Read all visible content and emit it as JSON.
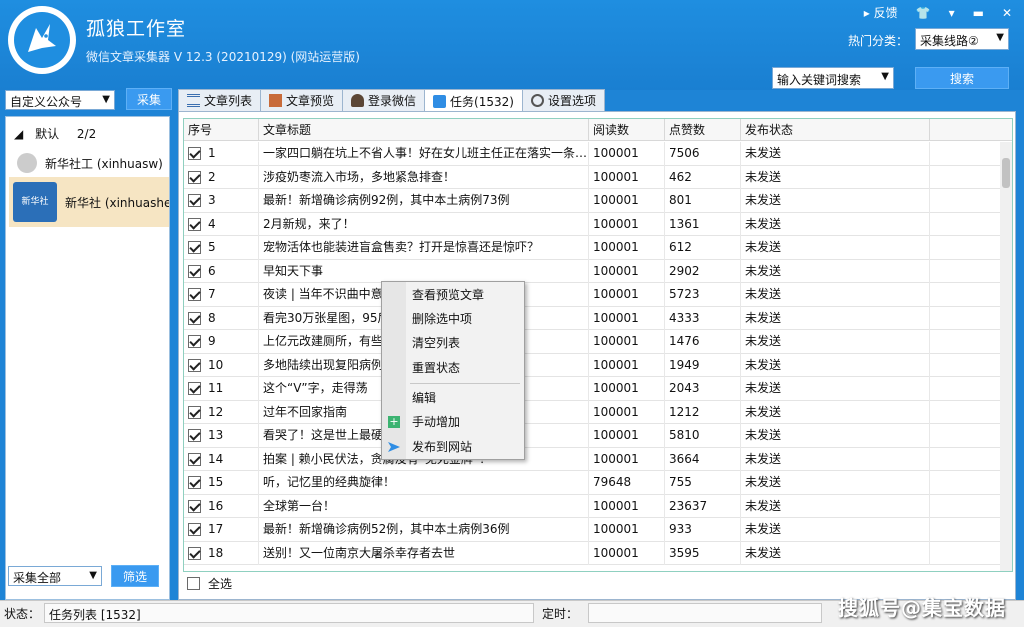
{
  "app": {
    "title": "孤狼工作室",
    "subtitle": "微信文章采集器  V 12.3 (20210129) (网站运营版)"
  },
  "top_links": {
    "feedback": "反馈"
  },
  "hot": {
    "label": "热门分类：",
    "value": "采集线路②"
  },
  "search": {
    "keyword_select": "输入关键词搜索",
    "button": "搜索"
  },
  "left": {
    "source_select": "自定义公众号",
    "collect_button": "采集",
    "group_name": "默认",
    "group_count": "2/2",
    "accounts": [
      {
        "name": "新华社工 (xinhuasw)",
        "icon_text": ""
      },
      {
        "name": "新华社 (xinhuashe",
        "icon_text": "新华社"
      }
    ],
    "all_select": "采集全部",
    "filter_button": "筛选"
  },
  "tabs": [
    {
      "label": "文章列表"
    },
    {
      "label": "文章预览"
    },
    {
      "label": "登录微信"
    },
    {
      "label": "任务(1532)"
    },
    {
      "label": "设置选项"
    }
  ],
  "table": {
    "headers": [
      "序号",
      "文章标题",
      "阅读数",
      "点赞数",
      "发布状态"
    ],
    "rows": [
      {
        "no": "1",
        "title": "一家四口躺在坑上不省人事！好在女儿班主任正在落实一条…",
        "reads": "100001",
        "likes": "7506",
        "status": "未发送"
      },
      {
        "no": "2",
        "title": "涉疫奶枣流入市场，多地紧急排查！",
        "reads": "100001",
        "likes": "462",
        "status": "未发送"
      },
      {
        "no": "3",
        "title": "最新！新增确诊病例92例，其中本土病例73例",
        "reads": "100001",
        "likes": "801",
        "status": "未发送"
      },
      {
        "no": "4",
        "title": "2月新规，来了！",
        "reads": "100001",
        "likes": "1361",
        "status": "未发送"
      },
      {
        "no": "5",
        "title": "宠物活体也能装进盲盒售卖？打开是惊喜还是惊吓？",
        "reads": "100001",
        "likes": "612",
        "status": "未发送"
      },
      {
        "no": "6",
        "title": "早知天下事",
        "reads": "100001",
        "likes": "2902",
        "status": "未发送"
      },
      {
        "no": "7",
        "title": "夜读 | 当年不识曲中意",
        "reads": "100001",
        "likes": "5723",
        "status": "未发送"
      },
      {
        "no": "8",
        "title": "看完30万张星图，95后",
        "reads": "100001",
        "likes": "4333",
        "status": "未发送"
      },
      {
        "no": "9",
        "title": "上亿元改建厕所，有些",
        "reads": "100001",
        "likes": "1476",
        "status": "未发送"
      },
      {
        "no": "10",
        "title": "多地陆续出现复阳病例",
        "reads": "100001",
        "likes": "1949",
        "status": "未发送"
      },
      {
        "no": "11",
        "title": "这个“V”字，走得荡",
        "reads": "100001",
        "likes": "2043",
        "status": "未发送"
      },
      {
        "no": "12",
        "title": "过年不回家指南",
        "reads": "100001",
        "likes": "1212",
        "status": "未发送"
      },
      {
        "no": "13",
        "title": "看哭了！这是世上最硬",
        "reads": "100001",
        "likes": "5810",
        "status": "未发送"
      },
      {
        "no": "14",
        "title": "拍案 | 赖小民伏法，贪腐没有“免死金牌”！",
        "reads": "100001",
        "likes": "3664",
        "status": "未发送"
      },
      {
        "no": "15",
        "title": "听，记忆里的经典旋律！",
        "reads": "79648",
        "likes": "755",
        "status": "未发送"
      },
      {
        "no": "16",
        "title": "全球第一台！",
        "reads": "100001",
        "likes": "23637",
        "status": "未发送"
      },
      {
        "no": "17",
        "title": "最新！新增确诊病例52例，其中本土病例36例",
        "reads": "100001",
        "likes": "933",
        "status": "未发送"
      },
      {
        "no": "18",
        "title": "送别！又一位南京大屠杀幸存者去世",
        "reads": "100001",
        "likes": "3595",
        "status": "未发送"
      }
    ],
    "select_all": "全选"
  },
  "context_menu": {
    "items": [
      "查看预览文章",
      "删除选中项",
      "清空列表",
      "重置状态",
      "编辑",
      "手动增加",
      "发布到网站"
    ]
  },
  "status_bar": {
    "label": "状态：",
    "value": "任务列表 [1532]",
    "timer_label": "定时："
  },
  "watermark": "搜狐号@集宝数据",
  "colors": {
    "header_blue": "#1f8ee0",
    "button_blue": "#3a9af0",
    "selected_row": "#f6e5c3"
  }
}
